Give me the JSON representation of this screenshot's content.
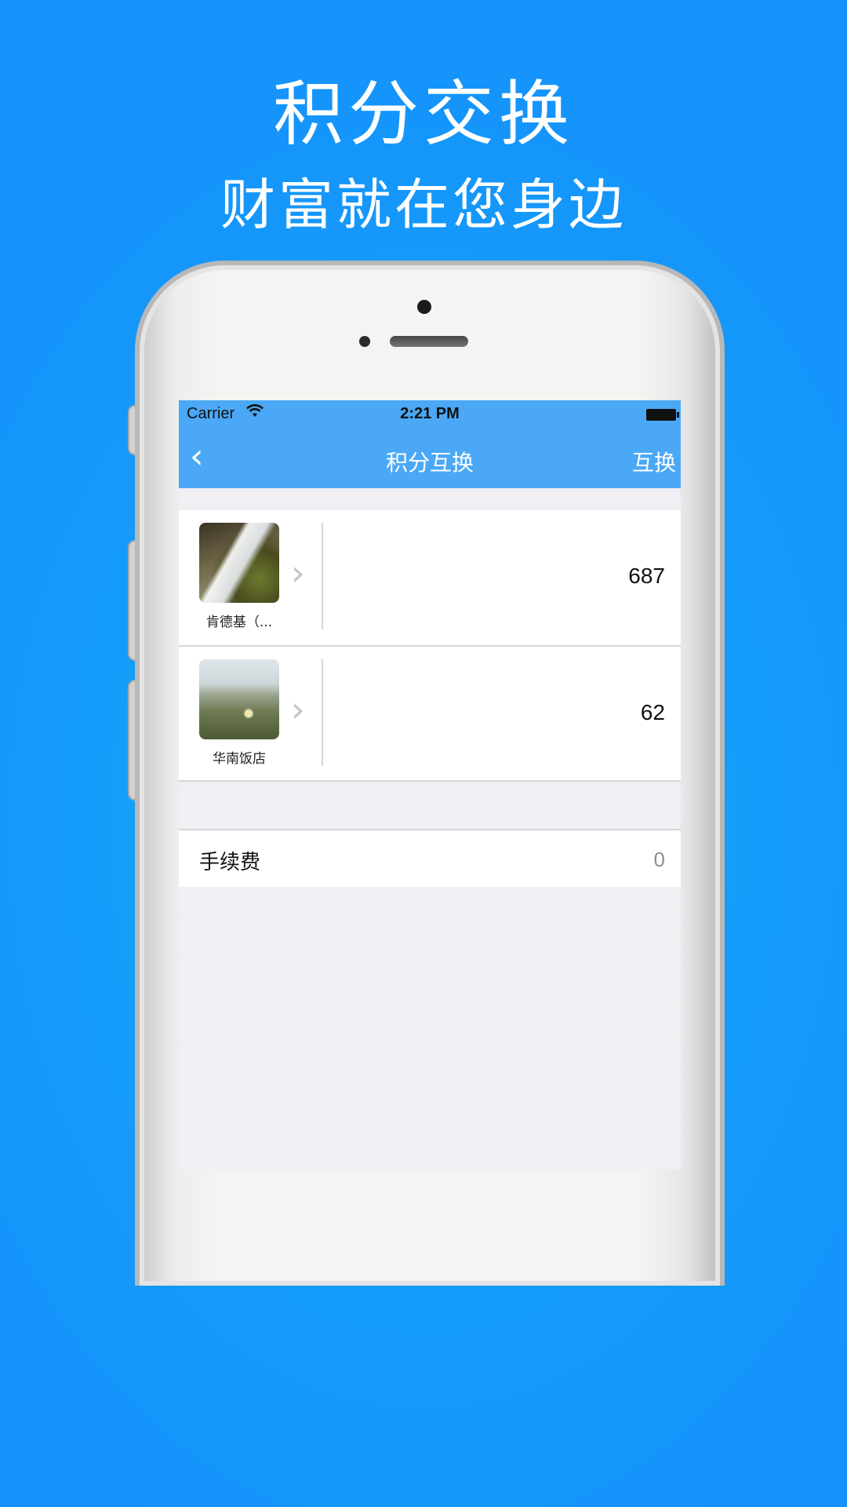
{
  "promo": {
    "headline": "积分交换",
    "subheadline": "财富就在您身边"
  },
  "status_bar": {
    "carrier": "Carrier",
    "wifi_icon": "wifi-icon",
    "time": "2:21 PM",
    "battery_icon": "battery-icon"
  },
  "nav": {
    "back_icon": "chevron-left-icon",
    "back_glyph": "‹",
    "title": "积分互换",
    "right_action": "互换",
    "bar_color": "#4aa8f6"
  },
  "exchange_rows": [
    {
      "store": "肯德基（...",
      "thumbnail": "waterfall-photo",
      "points": "687"
    },
    {
      "store": "华南饭店",
      "thumbnail": "meadow-photo",
      "points": "62"
    }
  ],
  "chevron_glyph": "›",
  "fee": {
    "label": "手续费",
    "value": "0"
  },
  "colors": {
    "background": "#159cfa",
    "screen_bg": "#efeff4"
  }
}
